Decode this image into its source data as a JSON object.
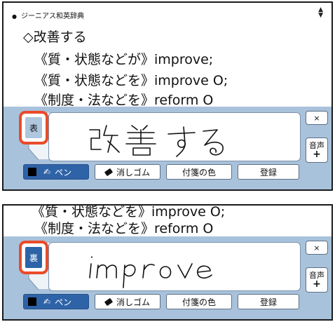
{
  "header": {
    "bullet": "●",
    "title": "ジーニアス和英辞典",
    "scroll_glyph": "▲▼"
  },
  "dictionary": {
    "headword": "◇改善する",
    "lines": [
      "《質・状態などが》improve;",
      "《質・状態などを》improve O;",
      "《制度・法などを》reform O"
    ],
    "clipped_line": "《質・状態などを》improve O;"
  },
  "flashcard": {
    "front_label": "表",
    "back_label": "裏",
    "close_label": "×",
    "sound_label": "音声",
    "sound_plus": "+",
    "front_handwriting": "改善する",
    "back_handwriting": "improve"
  },
  "toolbar": {
    "pen_label": "ペン",
    "eraser_label": "消しゴム",
    "sticky_color_label": "付箋の色",
    "register_label": "登録"
  },
  "colors": {
    "panel": "#a9c2dc",
    "highlight_border": "#ea4b2a",
    "pen_active": "#2f63a8",
    "back_tab": "#2d63a7"
  }
}
